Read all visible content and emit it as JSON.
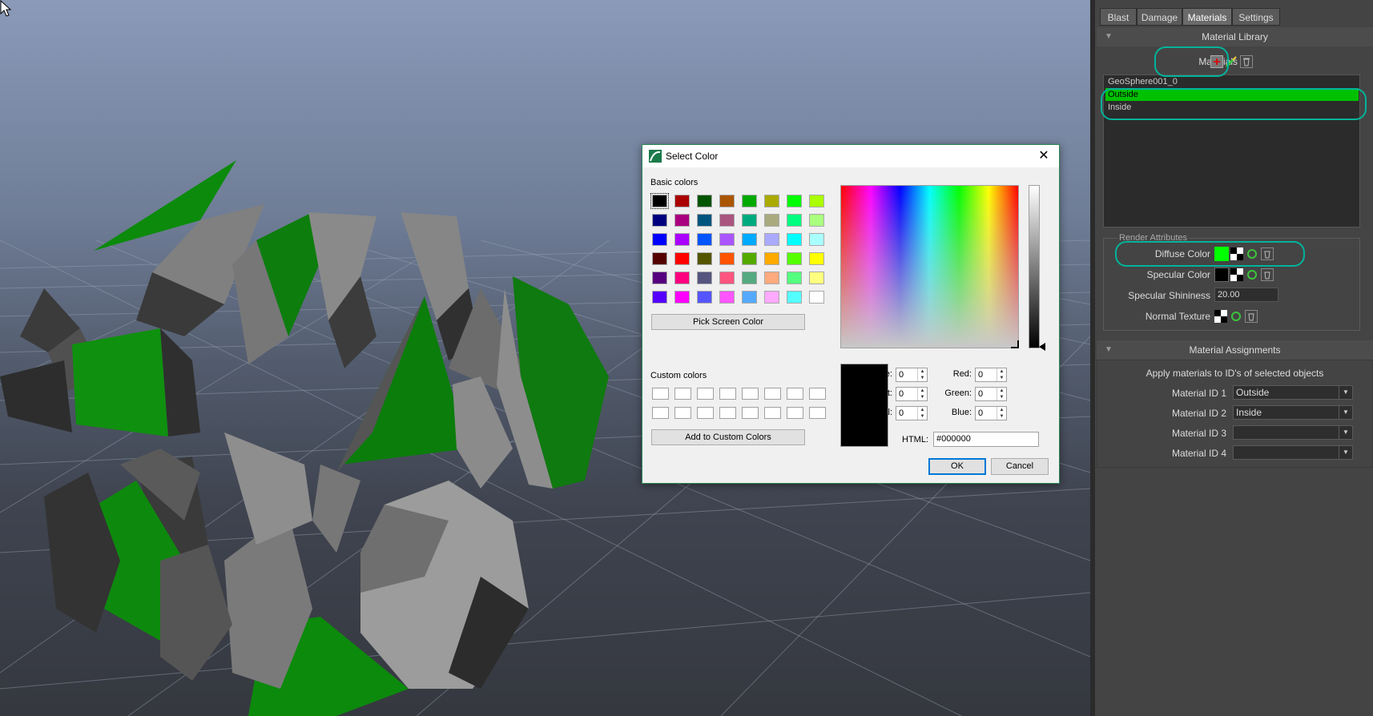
{
  "dialog": {
    "title": "Select Color",
    "close_glyph": "✕",
    "basic_colors_label": "Basic colors",
    "basic_colors": [
      [
        "#000000",
        "#aa0000",
        "#005500",
        "#aa5500",
        "#00aa00",
        "#aaaa00",
        "#00ff00",
        "#aaff00"
      ],
      [
        "#00007f",
        "#aa007f",
        "#00557f",
        "#aa557f",
        "#00aa7f",
        "#aaaa7f",
        "#00ff7f",
        "#aaff7f"
      ],
      [
        "#0000ff",
        "#aa00ff",
        "#0055ff",
        "#aa55ff",
        "#00aaff",
        "#aaaaff",
        "#00ffff",
        "#aaffff"
      ],
      [
        "#550000",
        "#ff0000",
        "#555500",
        "#ff5500",
        "#55aa00",
        "#ffaa00",
        "#55ff00",
        "#ffff00"
      ],
      [
        "#55007f",
        "#ff007f",
        "#55557f",
        "#ff557f",
        "#55aa7f",
        "#ffaa7f",
        "#55ff7f",
        "#ffff7f"
      ],
      [
        "#5500ff",
        "#ff00ff",
        "#5555ff",
        "#ff55ff",
        "#55aaff",
        "#ffaaff",
        "#55ffff",
        "#ffffff"
      ]
    ],
    "pick_screen_color": "Pick Screen Color",
    "custom_colors_label": "Custom colors",
    "add_to_custom": "Add to Custom Colors",
    "fields": {
      "hue": {
        "label": "Hue:",
        "value": "0"
      },
      "sat": {
        "label": "Sat:",
        "value": "0"
      },
      "val": {
        "label": "Val:",
        "value": "0"
      },
      "red": {
        "label": "Red:",
        "value": "0"
      },
      "green": {
        "label": "Green:",
        "value": "0"
      },
      "blue": {
        "label": "Blue:",
        "value": "0"
      }
    },
    "html_label": "HTML:",
    "html_value": "#000000",
    "ok": "OK",
    "cancel": "Cancel"
  },
  "panel": {
    "tabs": [
      "Blast",
      "Damage",
      "Materials",
      "Settings"
    ],
    "active_tab": "Materials",
    "material_library": {
      "title": "Material Library",
      "materials_label": "Materials",
      "items": [
        "GeoSphere001_0",
        "Outside",
        "Inside"
      ],
      "selected": "Outside"
    },
    "render_attributes": {
      "title": "Render Attributes",
      "diffuse_label": "Diffuse Color",
      "diffuse_color": "#00ff00",
      "specular_label": "Specular Color",
      "specular_color": "#000000",
      "shininess_label": "Specular Shininess",
      "shininess_value": "20.00",
      "normal_label": "Normal Texture"
    },
    "material_assignments": {
      "title": "Material Assignments",
      "hint": "Apply materials to ID's of selected objects",
      "ids": [
        {
          "label": "Material ID 1",
          "value": "Outside"
        },
        {
          "label": "Material ID 2",
          "value": "Inside"
        },
        {
          "label": "Material ID 3",
          "value": ""
        },
        {
          "label": "Material ID 4",
          "value": ""
        }
      ]
    },
    "highlight_color": "#00b39a",
    "selection_color": "#00c100"
  }
}
